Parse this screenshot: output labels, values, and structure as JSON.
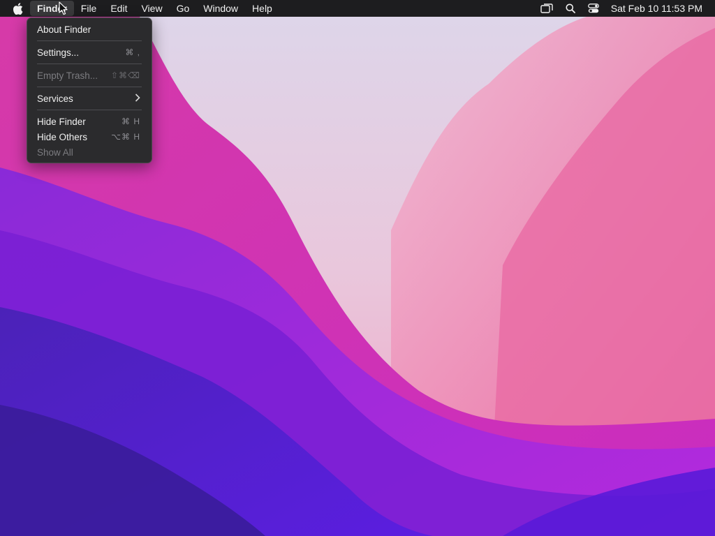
{
  "menubar": {
    "apple_icon": "apple-logo-icon",
    "menus": [
      "Finder",
      "File",
      "Edit",
      "View",
      "Go",
      "Window",
      "Help"
    ],
    "active_menu": "Finder",
    "status_icons": [
      "screen-mirroring-icon",
      "spotlight-search-icon",
      "control-center-icon"
    ],
    "clock": "Sat Feb 10  11:53 PM"
  },
  "finder_menu": {
    "items": [
      {
        "label": "About Finder",
        "shortcut": "",
        "enabled": true
      },
      {
        "label": "Settings...",
        "shortcut": "⌘ ,",
        "enabled": true
      },
      {
        "label": "Empty Trash...",
        "shortcut": "⇧⌘⌫",
        "enabled": false
      },
      {
        "label": "Services",
        "shortcut": "",
        "enabled": true,
        "submenu": true
      },
      {
        "label": "Hide Finder",
        "shortcut": "⌘ H",
        "enabled": true
      },
      {
        "label": "Hide Others",
        "shortcut": "⌥⌘ H",
        "enabled": true
      },
      {
        "label": "Show All",
        "shortcut": "",
        "enabled": false
      }
    ]
  },
  "colors": {
    "menubar_bg": "#1d1d1f",
    "menu_bg": "#2b2b2d",
    "wallpaper_pink": "#e0489a",
    "wallpaper_purple": "#6a1ed8"
  }
}
